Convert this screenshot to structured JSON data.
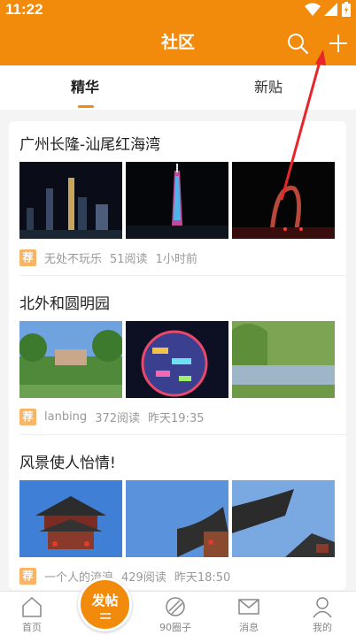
{
  "statusbar": {
    "time": "11:22"
  },
  "header": {
    "title": "社区"
  },
  "tabs": [
    {
      "label": "精华",
      "active": true
    },
    {
      "label": "新贴",
      "active": false
    }
  ],
  "posts": [
    {
      "title": "广州长隆-汕尾红海湾",
      "badge": "荐",
      "author": "无处不玩乐",
      "reads": "51阅读",
      "time": "1小时前"
    },
    {
      "title": "北外和圆明园",
      "badge": "荐",
      "author": "lanbing",
      "reads": "372阅读",
      "time": "昨天19:35"
    },
    {
      "title": "风景使人怡情!",
      "badge": "荐",
      "author": "一个人的流浪",
      "reads": "429阅读",
      "time": "昨天18:50"
    }
  ],
  "bottom_nav": {
    "home": "首页",
    "post_button": "发帖",
    "circles": "90圈子",
    "messages": "消息",
    "mine": "我的"
  },
  "colors": {
    "accent": "#f28a0b",
    "badge": "#f8b467"
  }
}
